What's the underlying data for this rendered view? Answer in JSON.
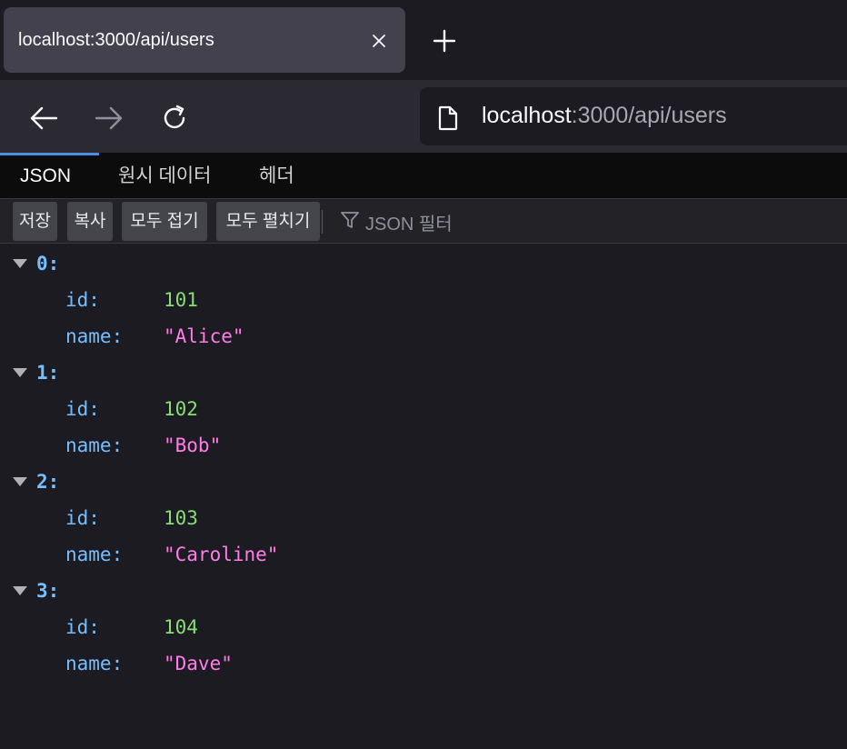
{
  "browser": {
    "tab_title": "localhost:3000/api/users",
    "url_host": "localhost",
    "url_rest": ":3000/api/users"
  },
  "viewer": {
    "tabs": [
      "JSON",
      "원시 데이터",
      "헤더"
    ],
    "active_tab": "JSON",
    "toolbar": {
      "save": "저장",
      "copy": "복사",
      "collapse_all": "모두 접기",
      "expand_all": "모두 펼치기",
      "filter_placeholder": "JSON 필터"
    }
  },
  "json": {
    "key_id": "id:",
    "key_name": "name:",
    "items": [
      {
        "index": "0:",
        "id": "101",
        "name": "\"Alice\""
      },
      {
        "index": "1:",
        "id": "102",
        "name": "\"Bob\""
      },
      {
        "index": "2:",
        "id": "103",
        "name": "\"Caroline\""
      },
      {
        "index": "3:",
        "id": "104",
        "name": "\"Dave\""
      }
    ]
  },
  "icons": [
    "close-icon",
    "plus-icon",
    "back-arrow-icon",
    "forward-arrow-icon",
    "reload-icon",
    "document-icon",
    "filter-icon",
    "twisty-down-icon"
  ],
  "colors": {
    "key": "#75bfff",
    "number": "#86de74",
    "string": "#ff7de9",
    "active_tab_indicator": "#4a90e2"
  }
}
